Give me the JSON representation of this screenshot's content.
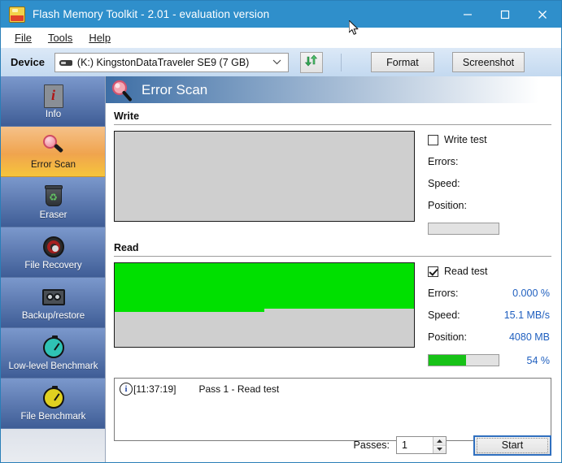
{
  "window": {
    "title": "Flash Memory Toolkit - 2.01 - evaluation version",
    "icon": "flash-drive-icon",
    "minimize_label": "—",
    "maximize_label": "□",
    "close_label": "✕",
    "titlebar_color": "#2f8fcb"
  },
  "menu": [
    {
      "label": "File",
      "accel": "F"
    },
    {
      "label": "Tools",
      "accel": "T"
    },
    {
      "label": "Help",
      "accel": "H"
    }
  ],
  "toolbar": {
    "device_label": "Device",
    "device_value": "(K:) KingstonDataTraveler SE9 (7 GB)",
    "device_icon": "usb-drive-icon",
    "refresh_icon": "refresh-icon",
    "format_label": "Format",
    "screenshot_label": "Screenshot"
  },
  "sidebar": {
    "items": [
      {
        "label": "Info",
        "icon": "info-document-icon",
        "selected": false
      },
      {
        "label": "Error Scan",
        "icon": "magnifier-icon",
        "selected": true
      },
      {
        "label": "Eraser",
        "icon": "trash-recycle-icon",
        "selected": false
      },
      {
        "label": "File Recovery",
        "icon": "lifebuoy-icon",
        "selected": false
      },
      {
        "label": "Backup/restore",
        "icon": "tape-cassette-icon",
        "selected": false
      },
      {
        "label": "Low-level Benchmark",
        "icon": "stopwatch-teal-icon",
        "selected": false
      },
      {
        "label": "File Benchmark",
        "icon": "stopwatch-yellow-icon",
        "selected": false
      }
    ]
  },
  "page": {
    "title": "Error Scan",
    "title_icon": "magnifier-icon"
  },
  "write": {
    "section_title": "Write",
    "checkbox_label": "Write test",
    "checked": false,
    "errors_label": "Errors:",
    "errors_value": "",
    "speed_label": "Speed:",
    "speed_value": "",
    "position_label": "Position:",
    "position_value": "",
    "progress_percent_label": "",
    "progress_percent": 0,
    "graph_fill_percent": 0
  },
  "read": {
    "section_title": "Read",
    "checkbox_label": "Read test",
    "checked": true,
    "errors_label": "Errors:",
    "errors_value": "0.000 %",
    "speed_label": "Speed:",
    "speed_value": "15.1 MB/s",
    "position_label": "Position:",
    "position_value": "4080 MB",
    "progress_percent_label": "54 %",
    "progress_percent": 54,
    "graph_fill_a_percent": 58,
    "graph_fill_b_percent": 54,
    "graph_color": "#00e000"
  },
  "log": {
    "entries": [
      {
        "icon": "info-icon",
        "time": "[11:37:19]",
        "message": "Pass 1 - Read test"
      }
    ]
  },
  "bottom": {
    "passes_label": "Passes:",
    "passes_value": "1",
    "start_label": "Start"
  },
  "colors": {
    "accent": "#2f8fcb",
    "progress_green": "#00e000",
    "value_blue": "#1f5fbf",
    "selected_tab": "#f0a44e"
  }
}
